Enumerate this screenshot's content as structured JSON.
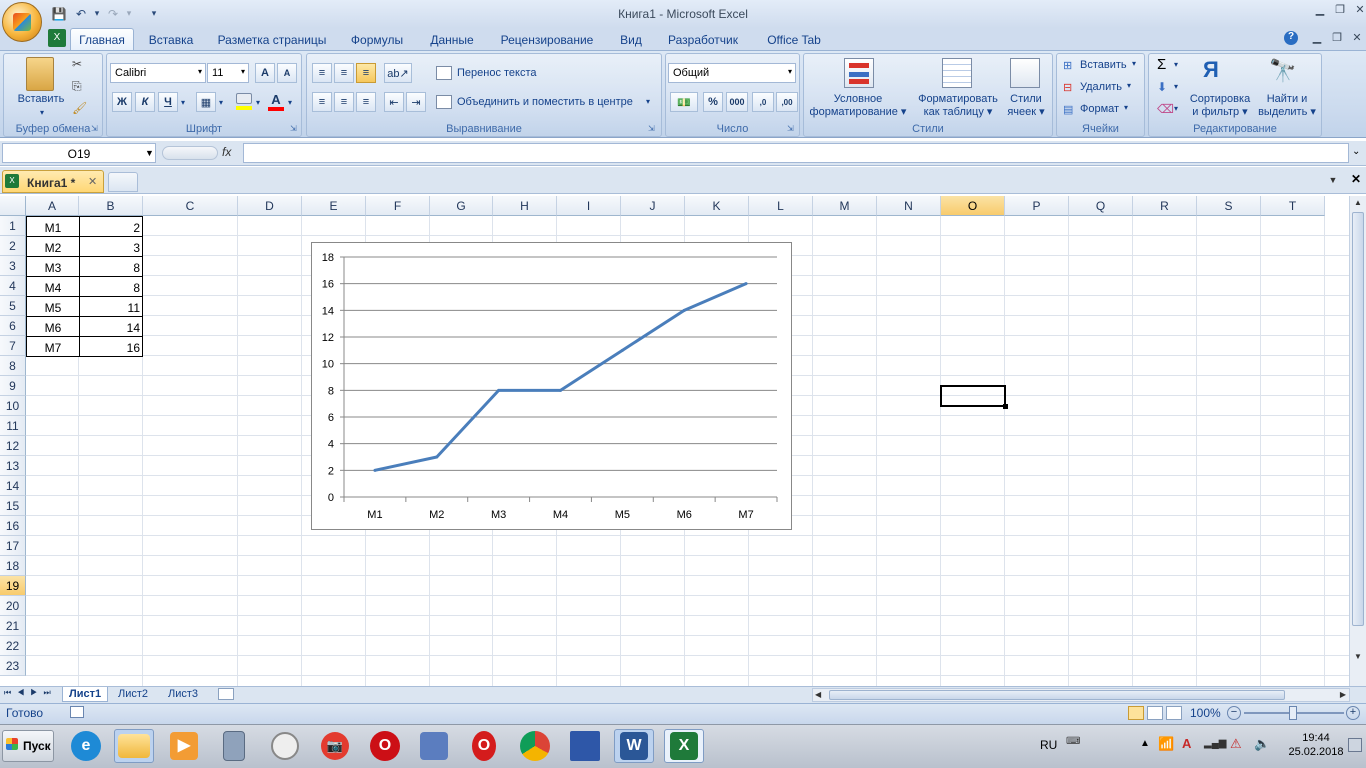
{
  "app": {
    "title": "Книга1 - Microsoft Excel"
  },
  "ribbon_tabs": [
    "Главная",
    "Вставка",
    "Разметка страницы",
    "Формулы",
    "Данные",
    "Рецензирование",
    "Вид",
    "Разработчик",
    "Office Tab"
  ],
  "clipboard": {
    "paste": "Вставить",
    "label": "Буфер обмена"
  },
  "font": {
    "name": "Calibri",
    "size": "11",
    "bold": "Ж",
    "italic": "К",
    "underline": "Ч",
    "label": "Шрифт",
    "grow": "A",
    "shrink": "A",
    "color_a": "A"
  },
  "alignment": {
    "wrap": "Перенос текста",
    "merge": "Объединить и поместить в центре",
    "label": "Выравнивание"
  },
  "number": {
    "format": "Общий",
    "label": "Число",
    "percent": "%",
    "thousands": "000",
    "inc": ",0",
    "dec": ",00"
  },
  "styles": {
    "cond1": "Условное",
    "cond2": "форматирование",
    "table1": "Форматировать",
    "table2": "как таблицу",
    "cell1": "Стили",
    "cell2": "ячеек",
    "label": "Стили"
  },
  "cells": {
    "insert": "Вставить",
    "delete": "Удалить",
    "format": "Формат",
    "label": "Ячейки"
  },
  "editing": {
    "sum": "Σ",
    "sort1": "Сортировка",
    "sort2": "и фильтр",
    "find1": "Найти и",
    "find2": "выделить",
    "label": "Редактирование"
  },
  "formula_bar": {
    "name_box": "O19",
    "fx": "fx",
    "value": ""
  },
  "workbook_tab": "Книга1 *",
  "columns": [
    "A",
    "B",
    "C",
    "D",
    "E",
    "F",
    "G",
    "H",
    "I",
    "J",
    "K",
    "L",
    "M",
    "N",
    "O",
    "P",
    "Q",
    "R",
    "S",
    "T"
  ],
  "rows": [
    "1",
    "2",
    "3",
    "4",
    "5",
    "6",
    "7",
    "8",
    "9",
    "10",
    "11",
    "12",
    "13",
    "14",
    "15",
    "16",
    "17",
    "18",
    "19",
    "20",
    "21",
    "22",
    "23"
  ],
  "table": [
    [
      "M1",
      "2"
    ],
    [
      "M2",
      "3"
    ],
    [
      "M3",
      "8"
    ],
    [
      "M4",
      "8"
    ],
    [
      "M5",
      "11"
    ],
    [
      "M6",
      "14"
    ],
    [
      "M7",
      "16"
    ]
  ],
  "chart_data": {
    "type": "line",
    "categories": [
      "M1",
      "M2",
      "M3",
      "M4",
      "M5",
      "M6",
      "M7"
    ],
    "series": [
      {
        "values": [
          2,
          3,
          8,
          8,
          11,
          14,
          16
        ],
        "color": "#4a7ebb"
      }
    ],
    "ylim": [
      0,
      18
    ],
    "yticks": [
      "0",
      "2",
      "4",
      "6",
      "8",
      "10",
      "12",
      "14",
      "16",
      "18"
    ],
    "grid": true,
    "legend": "none",
    "title": "",
    "xlabel": "",
    "ylabel": ""
  },
  "sheets": [
    "Лист1",
    "Лист2",
    "Лист3"
  ],
  "status": {
    "ready": "Готово",
    "zoom": "100%"
  },
  "taskbar": {
    "start": "Пуск",
    "lang": "RU",
    "time": "19:44",
    "date": "25.02.2018"
  }
}
